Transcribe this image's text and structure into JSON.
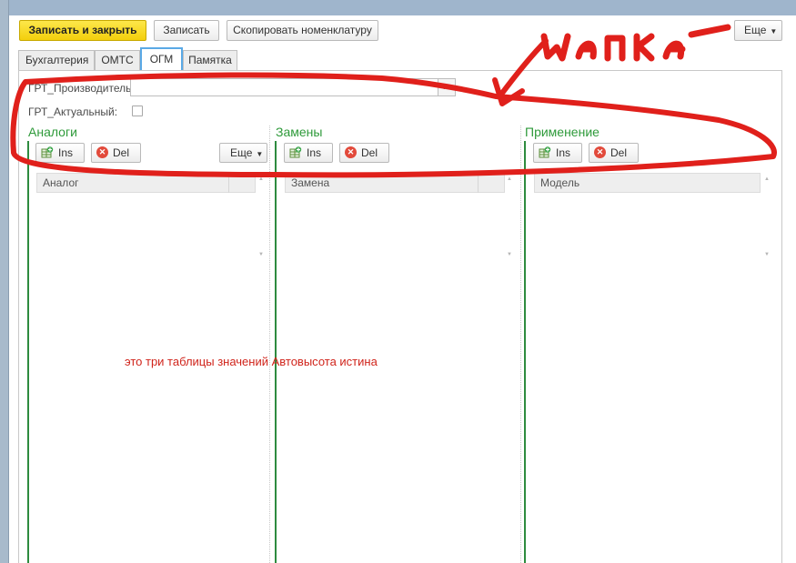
{
  "toolbar": {
    "save_close": "Записать и закрыть",
    "save": "Записать",
    "copy_nomenclature": "Скопировать номенклатуру",
    "more": "Еще"
  },
  "tabs": [
    {
      "label": "Бухгалтерия",
      "active": false
    },
    {
      "label": "ОМТС",
      "active": false
    },
    {
      "label": "ОГМ",
      "active": true
    },
    {
      "label": "Памятка",
      "active": false
    }
  ],
  "fields": {
    "manufacturer_label": "ГРТ_Производитель:",
    "manufacturer_value": "",
    "manufacturer_select_btn": "...",
    "actual_label": "ГРТ_Актуальный:",
    "actual_checked": false
  },
  "sections": [
    {
      "title": "Аналоги",
      "ins": "Ins",
      "del": "Del",
      "more": "Еще",
      "column": "Аналог"
    },
    {
      "title": "Замены",
      "ins": "Ins",
      "del": "Del",
      "column": "Замена"
    },
    {
      "title": "Применение",
      "ins": "Ins",
      "del": "Del",
      "column": "Модель"
    }
  ],
  "annotations": {
    "handwritten": "шапка",
    "note": "это три таблицы значений Автовысота истина"
  },
  "colors": {
    "primary_button": "#f3cf0c",
    "section_title": "#2e9a3a",
    "annotation": "#e0201b",
    "active_tab_border": "#5aa9e6"
  }
}
